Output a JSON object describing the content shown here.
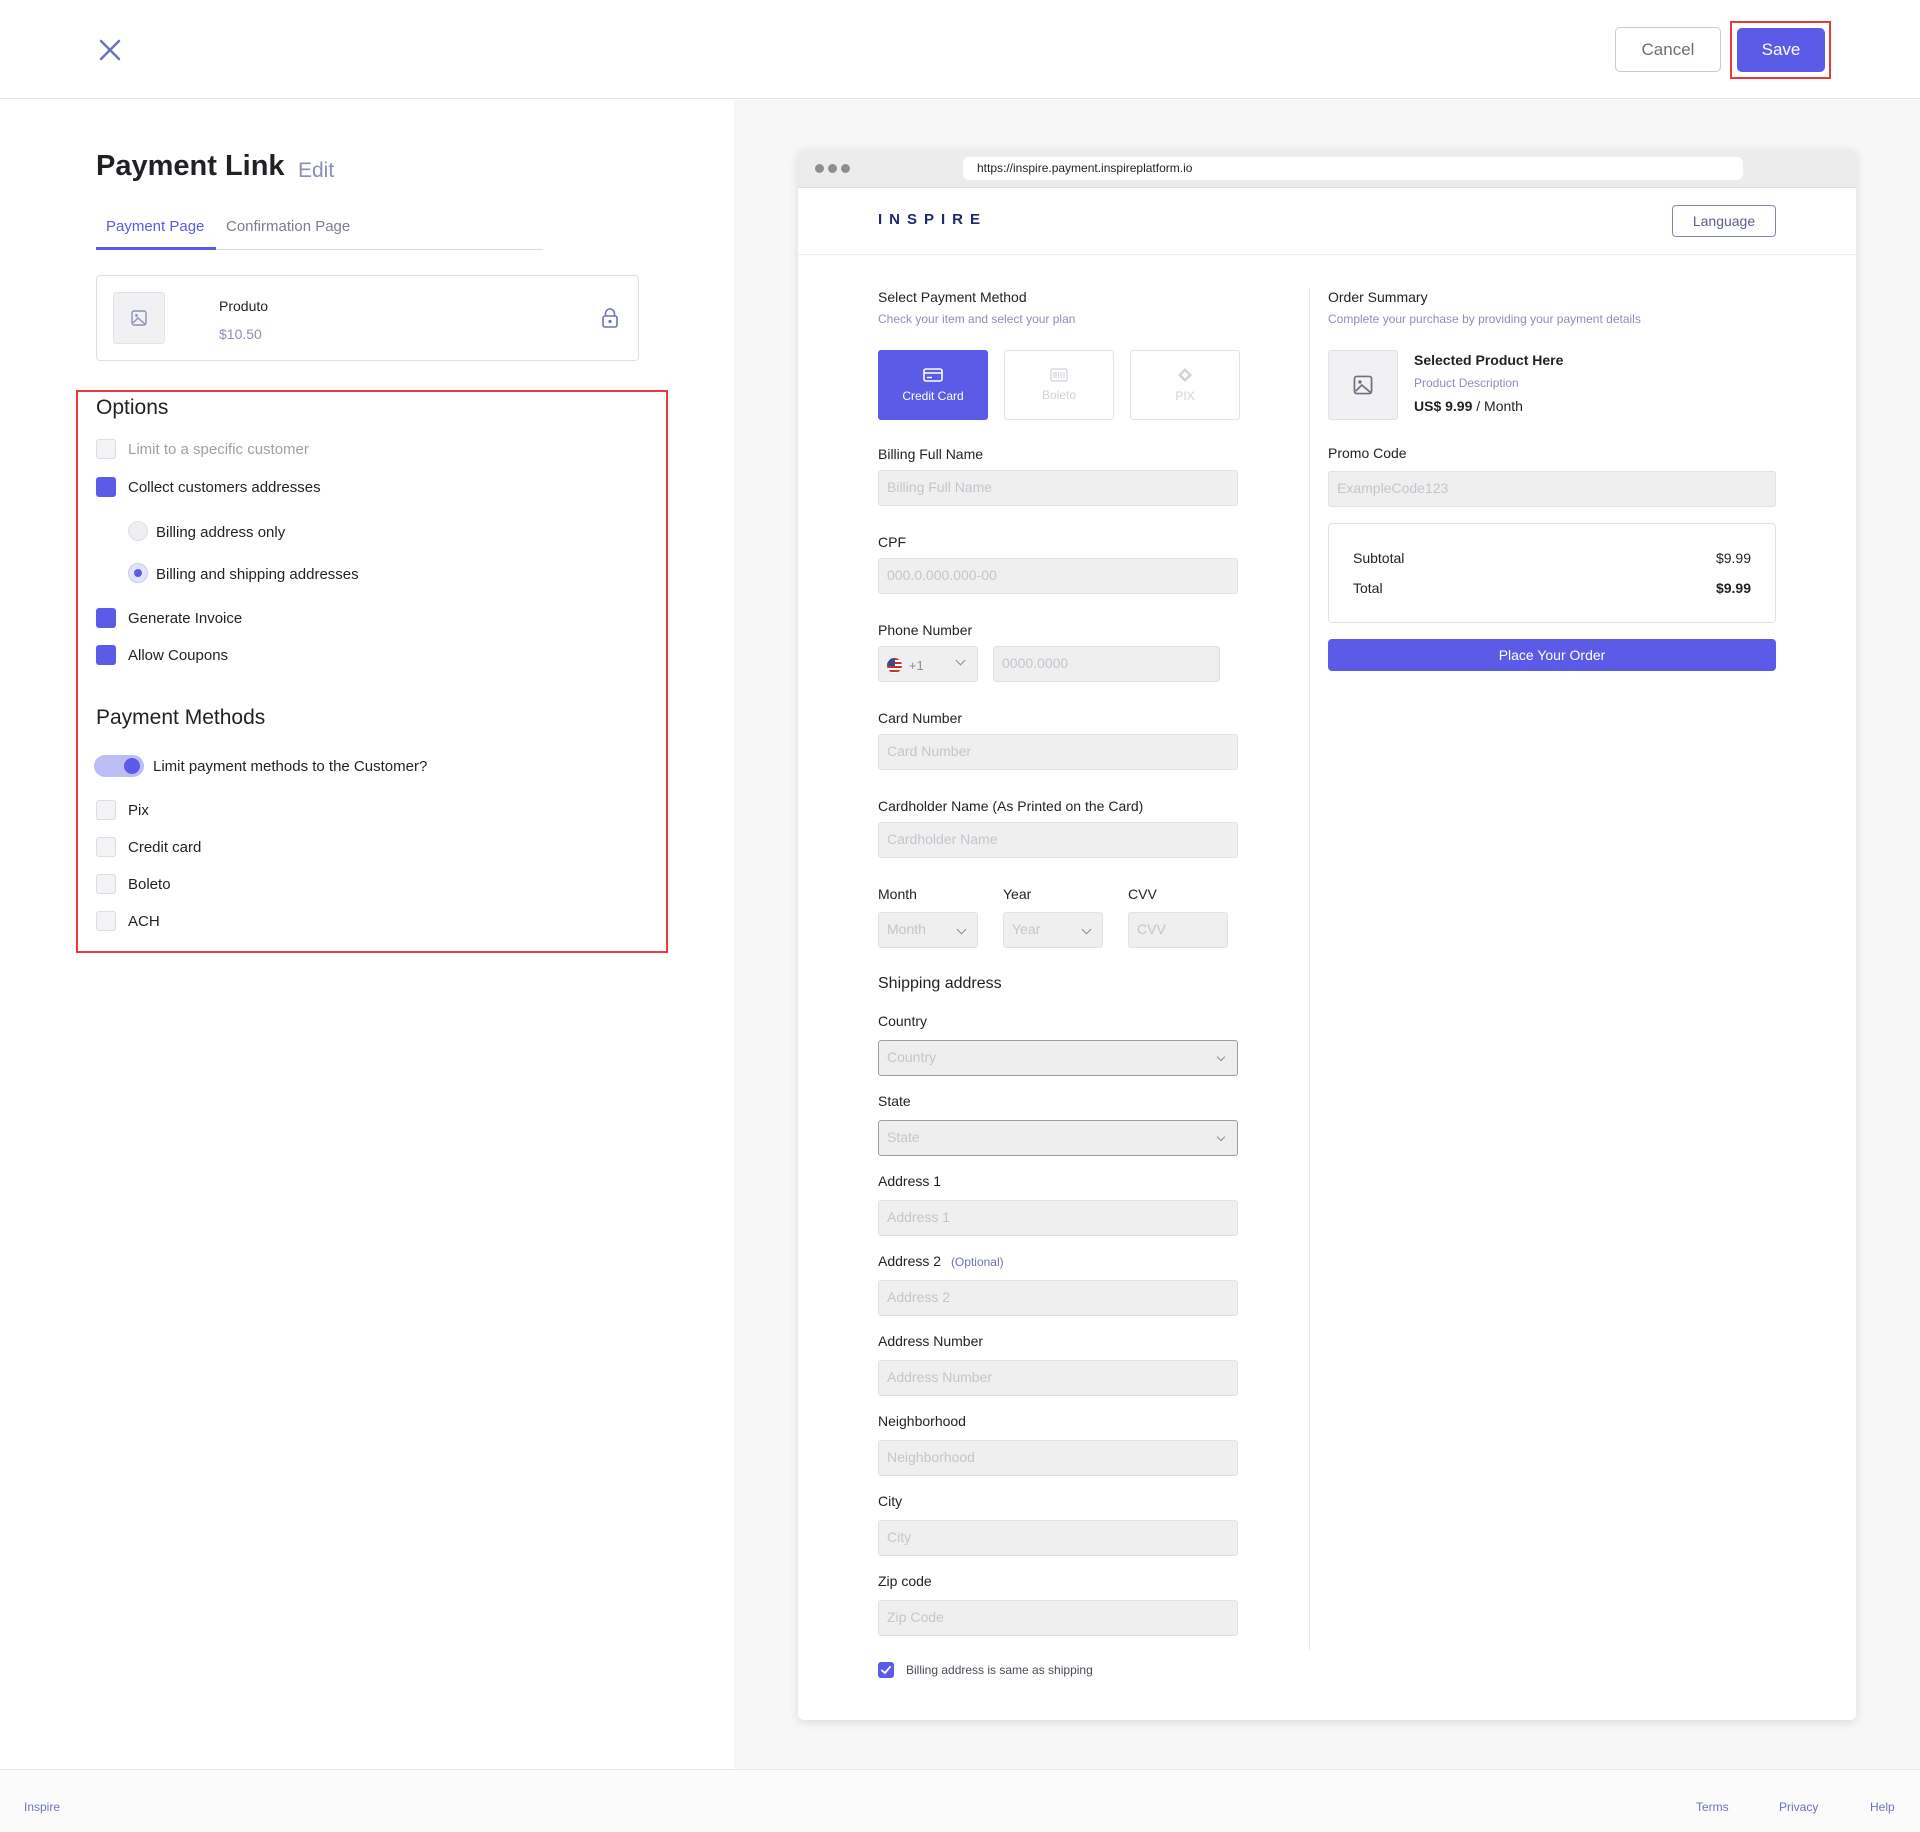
{
  "header": {
    "cancel_label": "Cancel",
    "save_label": "Save"
  },
  "editor": {
    "title": "Payment Link",
    "edit_label": "Edit",
    "tabs": [
      {
        "label": "Payment Page",
        "active": true
      },
      {
        "label": "Confirmation Page",
        "active": false
      }
    ],
    "product": {
      "name": "Produto",
      "price": "$10.50"
    },
    "options": {
      "heading": "Options",
      "items": [
        {
          "label": "Limit to a specific customer",
          "checked": false
        },
        {
          "label": "Collect customers addresses",
          "checked": true
        }
      ],
      "address_choices": [
        {
          "label": "Billing address only",
          "selected": false
        },
        {
          "label": "Billing and shipping addresses",
          "selected": true
        }
      ],
      "more": [
        {
          "label": "Generate Invoice",
          "checked": true
        },
        {
          "label": "Allow Coupons",
          "checked": true
        }
      ]
    },
    "payment_methods": {
      "heading": "Payment Methods",
      "toggle_label": "Limit payment methods to the Customer?",
      "toggle_on": true,
      "items": [
        {
          "label": "Pix",
          "checked": false
        },
        {
          "label": "Credit card",
          "checked": false
        },
        {
          "label": "Boleto",
          "checked": false
        },
        {
          "label": "ACH",
          "checked": false
        }
      ]
    }
  },
  "preview": {
    "url": "https://inspire.payment.inspireplatform.io",
    "brand": "INSPIRE",
    "language_label": "Language",
    "select_method": {
      "title": "Select Payment Method",
      "subtitle": "Check your item and select your plan",
      "tiles": [
        {
          "label": "Credit Card",
          "active": true,
          "icon": "credit-card-icon"
        },
        {
          "label": "Boleto",
          "active": false,
          "icon": "barcode-icon"
        },
        {
          "label": "PIX",
          "active": false,
          "icon": "pix-icon"
        }
      ]
    },
    "fields": {
      "billing_name": {
        "label": "Billing Full Name",
        "placeholder": "Billing Full Name"
      },
      "cpf": {
        "label": "CPF",
        "placeholder": "000.0.000.000-00"
      },
      "phone": {
        "label": "Phone Number",
        "code": "+1",
        "placeholder": "0000.0000"
      },
      "card_number": {
        "label": "Card Number",
        "placeholder": "Card Number"
      },
      "cardholder": {
        "label": "Cardholder Name (As Printed on the Card)",
        "placeholder": "Cardholder Name"
      },
      "month": {
        "label": "Month",
        "placeholder": "Month"
      },
      "year": {
        "label": "Year",
        "placeholder": "Year"
      },
      "cvv": {
        "label": "CVV",
        "placeholder": "CVV"
      }
    },
    "shipping": {
      "heading": "Shipping address",
      "country": {
        "label": "Country",
        "placeholder": "Country"
      },
      "state": {
        "label": "State",
        "placeholder": "State"
      },
      "address1": {
        "label": "Address 1",
        "placeholder": "Address 1"
      },
      "address2": {
        "label": "Address 2",
        "optional": "(Optional)",
        "placeholder": "Address 2"
      },
      "address_number": {
        "label": "Address Number",
        "placeholder": "Address Number"
      },
      "neighborhood": {
        "label": "Neighborhood",
        "placeholder": "Neighborhood"
      },
      "city": {
        "label": "City",
        "placeholder": "City"
      },
      "zip": {
        "label": "Zip code",
        "placeholder": "Zip Code"
      },
      "same_as_shipping": "Billing address is same as shipping"
    },
    "summary": {
      "title": "Order Summary",
      "subtitle": "Complete your purchase by providing your payment details",
      "product_name": "Selected Product Here",
      "product_desc": "Product Description",
      "product_price": "US$ 9.99",
      "product_period": "/ Month",
      "promo_label": "Promo Code",
      "promo_placeholder": "ExampleCode123",
      "subtotal_label": "Subtotal",
      "subtotal_value": "$9.99",
      "total_label": "Total",
      "total_value": "$9.99",
      "order_button": "Place Your Order"
    }
  },
  "footer": {
    "brand": "Inspire",
    "links": [
      "Terms",
      "Privacy",
      "Help"
    ]
  },
  "colors": {
    "accent": "#5b5be8",
    "highlight": "#e53b3b"
  }
}
